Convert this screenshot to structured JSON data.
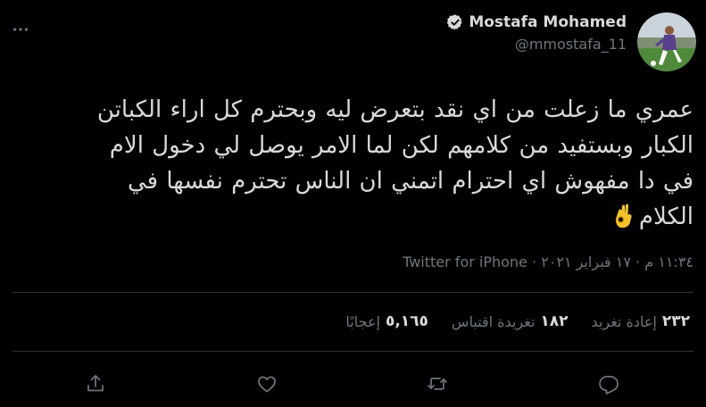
{
  "header": {
    "display_name": "Mostafa Mohamed",
    "handle": "@mmostafa_11",
    "verified_icon": "verified-badge-icon",
    "avatar_alt": "profile photo"
  },
  "tweet": {
    "lines": [
      "عمري ما زعلت من اي نقد بتعرض ليه وبحترم كل اراء الكباتن",
      "الكبار وبستفيد من كلامهم لكن لما الامر يوصل لي دخول الام",
      "في دا مفهوش اي احترام اتمني ان الناس تحترم نفسها في",
      "الكلام"
    ],
    "emoji": "ok-hand-emoji"
  },
  "meta": {
    "time": "١١:٣٤ م",
    "separator": "·",
    "date": "١٧ فبراير ٢٠٢١",
    "source": "Twitter for iPhone"
  },
  "stats": {
    "retweets_count": "٢٣٢",
    "retweets_label": "إعادة تغريد",
    "quotes_count": "١٨٢",
    "quotes_label": "تغريدة اقتباس",
    "likes_count": "٥,١٦٥",
    "likes_label": "إعجابًا"
  },
  "actions": [
    "reply-icon",
    "retweet-icon",
    "like-icon",
    "share-icon"
  ],
  "colors": {
    "background": "#000000",
    "text": "#d9d9d9",
    "secondary": "#6e767d",
    "divider": "#2f3336"
  }
}
